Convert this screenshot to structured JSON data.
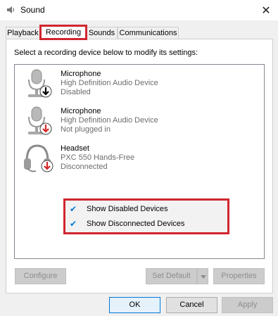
{
  "window": {
    "title": "Sound",
    "close_glyph": "✕",
    "icon": "speaker-icon"
  },
  "tabs": [
    {
      "label": "Playback",
      "active": false
    },
    {
      "label": "Recording",
      "active": true
    },
    {
      "label": "Sounds",
      "active": false
    },
    {
      "label": "Communications",
      "active": false
    }
  ],
  "instruction": "Select a recording device below to modify its settings:",
  "devices": [
    {
      "name": "Microphone",
      "description": "High Definition Audio Device",
      "status": "Disabled",
      "icon": "microphone-icon",
      "badge": "disabled-arrow-icon"
    },
    {
      "name": "Microphone",
      "description": "High Definition Audio Device",
      "status": "Not plugged in",
      "icon": "microphone-icon",
      "badge": "unplugged-arrow-icon"
    },
    {
      "name": "Headset",
      "description": "PXC 550 Hands-Free",
      "status": "Disconnected",
      "icon": "headset-icon",
      "badge": "disconnected-arrow-icon"
    }
  ],
  "context_menu": {
    "items": [
      {
        "label": "Show Disabled Devices",
        "checked": true
      },
      {
        "label": "Show Disconnected Devices",
        "checked": true
      }
    ],
    "check_glyph": "✔"
  },
  "buttons": {
    "configure": "Configure",
    "set_default": "Set Default",
    "properties": "Properties",
    "ok": "OK",
    "cancel": "Cancel",
    "apply": "Apply"
  },
  "colors": {
    "highlight": "#d1262f",
    "check": "#0078d7",
    "badge_red": "#d62828"
  }
}
